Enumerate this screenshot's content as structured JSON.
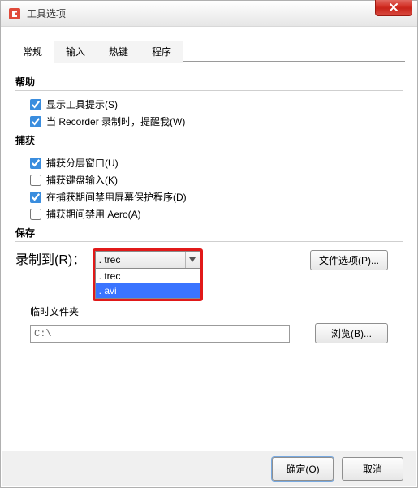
{
  "titlebar": {
    "title": "工具选项"
  },
  "tabs": {
    "items": [
      {
        "label": "常规"
      },
      {
        "label": "输入"
      },
      {
        "label": "热键"
      },
      {
        "label": "程序"
      }
    ],
    "activeIndex": 0
  },
  "sections": {
    "help": {
      "title": "帮助",
      "items": [
        {
          "label": "显示工具提示(S)",
          "checked": true
        },
        {
          "label": "当 Recorder 录制时，提醒我(W)",
          "checked": true
        }
      ]
    },
    "capture": {
      "title": "捕获",
      "items": [
        {
          "label": "捕获分层窗口(U)",
          "checked": true
        },
        {
          "label": "捕获键盘输入(K)",
          "checked": false
        },
        {
          "label": "在捕获期间禁用屏幕保护程序(D)",
          "checked": true
        },
        {
          "label": "捕获期间禁用 Aero(A)",
          "checked": false
        }
      ]
    },
    "save": {
      "title": "保存",
      "recordToLabel": "录制到(R)：",
      "recordToValue": ". trec",
      "formatOptions": [
        {
          "label": ". trec",
          "selected": false
        },
        {
          "label": ". avi",
          "selected": true
        }
      ],
      "fileOptionsBtn": "文件选项(P)...",
      "tempFolderLabel": "临时文件夹",
      "pathValue": "C:\\",
      "browseBtn": "浏览(B)..."
    }
  },
  "buttons": {
    "ok": "确定(O)",
    "cancel": "取消"
  }
}
